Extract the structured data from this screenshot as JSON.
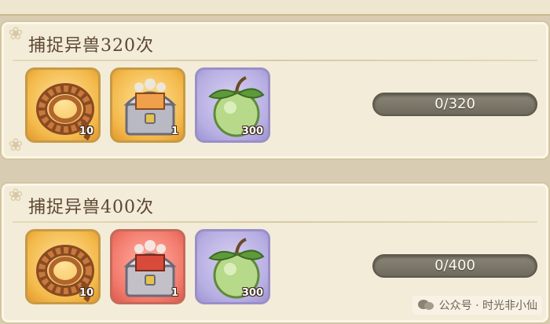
{
  "tasks": [
    {
      "title": "捕捉异兽320次",
      "rewards": [
        {
          "icon": "rope-coil-icon",
          "quantity": "10",
          "rarity": "gold"
        },
        {
          "icon": "treasure-chest-icon",
          "quantity": "1",
          "rarity": "gold"
        },
        {
          "icon": "green-fruit-icon",
          "quantity": "300",
          "rarity": "purple"
        }
      ],
      "progress": {
        "text": "0/320",
        "current": 0,
        "total": 320
      }
    },
    {
      "title": "捕捉异兽400次",
      "rewards": [
        {
          "icon": "rope-coil-icon",
          "quantity": "10",
          "rarity": "gold"
        },
        {
          "icon": "red-treasure-chest-icon",
          "quantity": "1",
          "rarity": "red"
        },
        {
          "icon": "green-fruit-icon",
          "quantity": "300",
          "rarity": "purple"
        }
      ],
      "progress": {
        "text": "0/400",
        "current": 0,
        "total": 400
      }
    }
  ],
  "watermark": {
    "text": "公众号 · 时光非小仙"
  },
  "colors": {
    "gold": "#f3b94b",
    "red": "#f2796a",
    "purple": "#b7aee2",
    "panel": "#f3ecd8"
  }
}
